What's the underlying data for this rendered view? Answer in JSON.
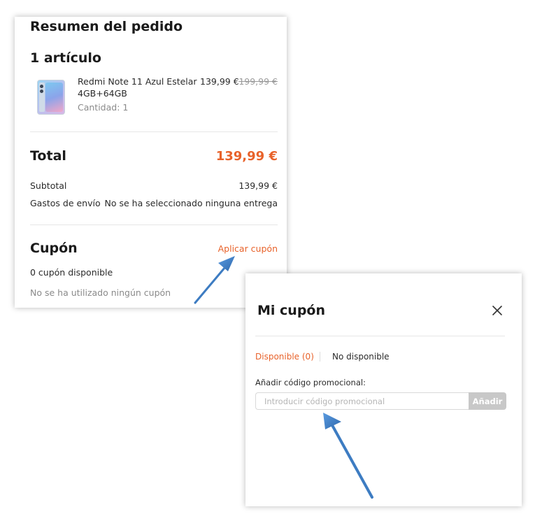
{
  "order": {
    "title": "Resumen del pedido",
    "items_heading": "1 artículo",
    "product": {
      "name": "Redmi Note 11 Azul Estelar",
      "variant": "4GB+64GB",
      "quantity": "Cantidad: 1",
      "price": "139,99 €",
      "old_price": "199,99 €"
    },
    "total_label": "Total",
    "total_value": "139,99 €",
    "subtotal_label": "Subtotal",
    "subtotal_value": "139,99 €",
    "shipping_label": "Gastos de envío",
    "shipping_value": "No se ha seleccionado ninguna entrega",
    "coupon_heading": "Cupón",
    "apply_coupon": "Aplicar cupón",
    "available_count": "0 cupón disponible",
    "no_coupon_used": "No se ha utilizado ningún cupón"
  },
  "dialog": {
    "title": "Mi cupón",
    "tabs": [
      {
        "label": "Disponible (0)",
        "active": true
      },
      {
        "label": "No disponible",
        "active": false
      }
    ],
    "promo_label": "Añadir código promocional:",
    "promo_placeholder": "Introducir código promocional",
    "add_button": "Añadir"
  },
  "colors": {
    "accent": "#e8622a",
    "arrow": "#3d7cc2",
    "disabled_button": "#c8c8c8"
  }
}
